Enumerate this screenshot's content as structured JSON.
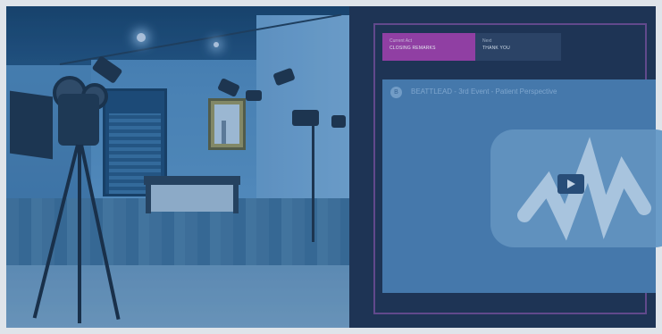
{
  "schedule": {
    "current": {
      "kicker": "Current Act",
      "title": "CLOSING REMARKS",
      "color": "#a13fa9"
    },
    "next": {
      "kicker": "Next",
      "title": "THANK YOU",
      "color": "#2e4463"
    }
  },
  "video": {
    "channel_initial": "B",
    "title": "BEATTLEAD - 3rd Event - Patient Perspective",
    "icon": "youtube-play-icon"
  },
  "photo": {
    "subject": "photo studio with film camera, lights and bench",
    "icon": "studio-photo"
  },
  "colors": {
    "accent": "#a13fa9",
    "panel": "#1f3350",
    "tint": "#2a5d86"
  }
}
